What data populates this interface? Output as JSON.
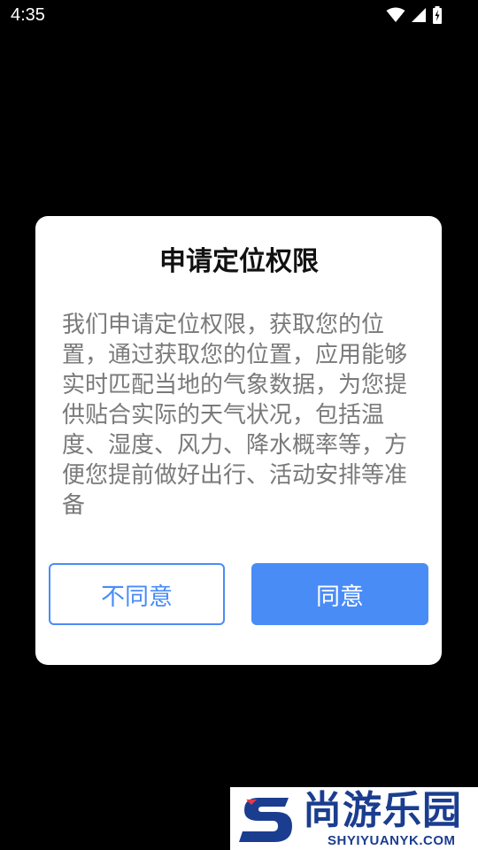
{
  "status_bar": {
    "time": "4:35",
    "icons": [
      "wifi-icon",
      "cell-signal-icon",
      "battery-charging-icon"
    ]
  },
  "dialog": {
    "title": "申请定位权限",
    "body": "我们申请定位权限，获取您的位置，通过获取您的位置，应用能够实时匹配当地的气象数据，为您提供贴合实际的天气状况，包括温度、湿度、风力、降水概率等，方便您提前做好出行、活动安排等准备",
    "disagree_label": "不同意",
    "agree_label": "同意"
  },
  "watermark": {
    "name": "尚游乐园",
    "url": "SHYIYUANYK.COM"
  },
  "colors": {
    "accent": "#4a8cf6",
    "background": "#000000",
    "dialog_bg": "#ffffff",
    "body_text": "#7a7a7a",
    "watermark": "#1b3d8f"
  }
}
